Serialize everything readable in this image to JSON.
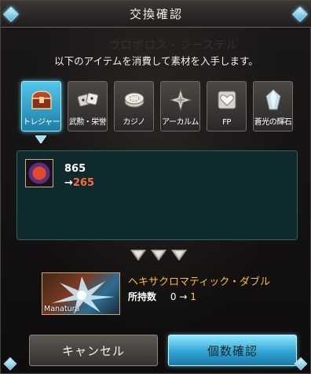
{
  "dialog": {
    "title": "交換確認",
    "watermark": "ウロボロス・ジーステル",
    "instruction": "以下のアイテムを消費して素材を入手します。"
  },
  "categories": [
    {
      "label": "トレジャー",
      "icon": "treasure-chest-icon",
      "active": true
    },
    {
      "label": "武勲・栄誉",
      "icon": "dice-icon",
      "active": false
    },
    {
      "label": "カジノ",
      "icon": "casino-chips-icon",
      "active": false
    },
    {
      "label": "アーカルム",
      "icon": "arcarum-star-icon",
      "active": false
    },
    {
      "label": "FP",
      "icon": "heart-icon",
      "active": false
    },
    {
      "label": "蒼光の輝石",
      "icon": "crystal-icon",
      "active": false
    }
  ],
  "consume": {
    "quantity": "865",
    "arrow": "→",
    "after": "265"
  },
  "result": {
    "thumb_label": "Manatura",
    "name": "ヘキサクロマティック・ダブル",
    "owned_label": "所持数",
    "owned_before": "0",
    "owned_arrow": "→",
    "owned_after": "1"
  },
  "buttons": {
    "cancel": "キャンセル",
    "confirm": "個数確認"
  },
  "colors": {
    "accent": "#4ccaf0",
    "highlight": "#ffb83a",
    "reduce": "#ff6a3a"
  }
}
